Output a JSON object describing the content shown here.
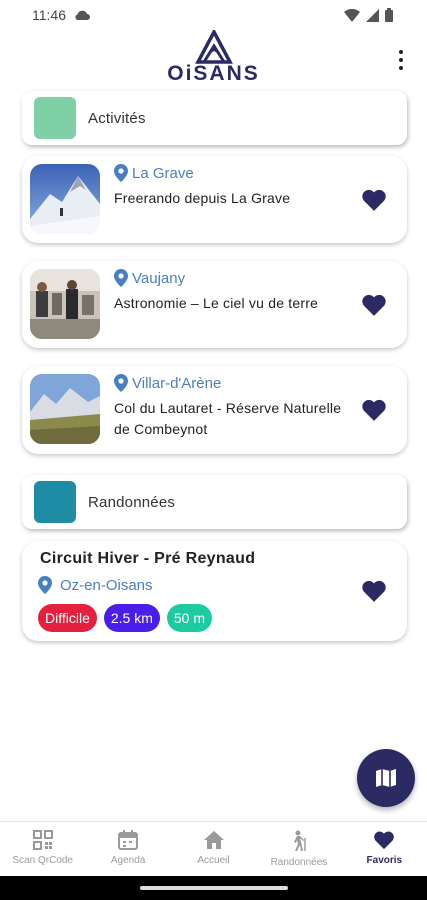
{
  "status_bar": {
    "time": "11:46"
  },
  "header": {
    "logo_text": "OiSANS"
  },
  "sections": [
    {
      "title": "Activités",
      "color": "#7fcfa7"
    },
    {
      "title": "Randonnées",
      "color": "#1d8ca4"
    }
  ],
  "activities": [
    {
      "location": "La Grave",
      "description": "Freerando depuis La Grave"
    },
    {
      "location": "Vaujany",
      "description": "Astronomie – Le ciel vu de terre"
    },
    {
      "location": "Villar-d'Arène",
      "description": "Col du Lautaret - Réserve Naturelle de Combeynot"
    }
  ],
  "hike": {
    "title": "Circuit Hiver - Pré Reynaud",
    "location": "Oz-en-Oisans",
    "tags": [
      {
        "label": "Difficile",
        "color": "#e5203f"
      },
      {
        "label": "2.5 km",
        "color": "#4b1de8"
      },
      {
        "label": "50 m",
        "color": "#1dcba0"
      }
    ]
  },
  "colors": {
    "brand": "#2c2a63",
    "location": "#4a7ec2"
  },
  "bottom_nav": [
    {
      "label": "Scan QrCode",
      "icon": "qr-code-icon"
    },
    {
      "label": "Agenda",
      "icon": "calendar-icon"
    },
    {
      "label": "Accueil",
      "icon": "home-icon"
    },
    {
      "label": "Randonnées",
      "icon": "hiker-icon"
    },
    {
      "label": "Favoris",
      "icon": "heart-icon",
      "active": true
    }
  ]
}
